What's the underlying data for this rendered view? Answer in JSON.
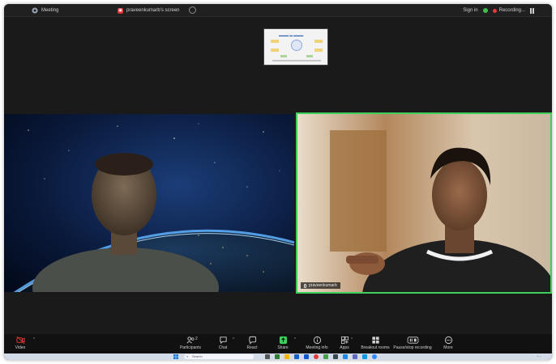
{
  "titlebar": {
    "app_title": "Meeting",
    "share_label": "praveenkumarb's screen",
    "sign_in": "Sign in",
    "recording": "Recording..."
  },
  "participants": {
    "right_name": "praveenkumarb"
  },
  "toolbar": {
    "video": "Video",
    "participants": "Participants",
    "participants_count": "2",
    "chat": "Chat",
    "react": "React",
    "share": "Share",
    "meeting_info": "Meeting info",
    "apps": "Apps",
    "breakout_rooms": "Breakout rooms",
    "pause_stop_recording": "Pause/stop recording",
    "more": "More"
  },
  "taskbar": {
    "search_placeholder": "Search"
  },
  "colors": {
    "active_speaker": "#3ecf5a",
    "video_off": "#e53935",
    "share_green": "#3ecf5a"
  }
}
